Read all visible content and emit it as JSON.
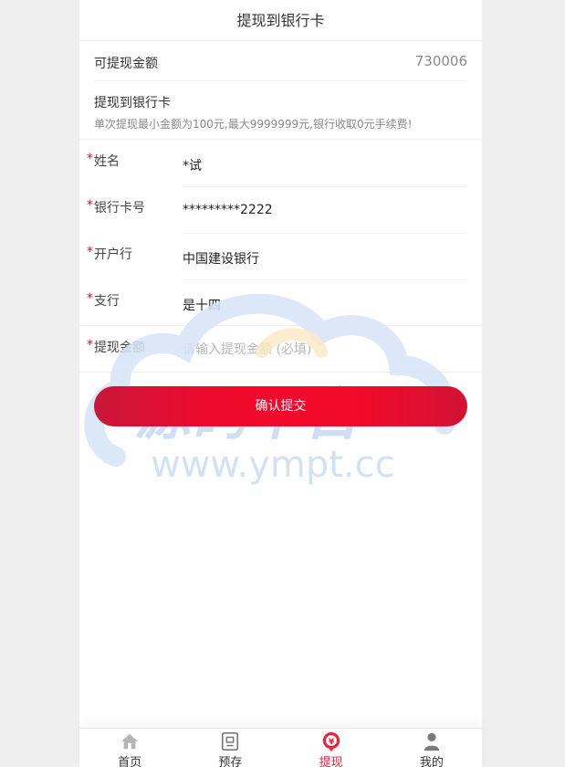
{
  "header": {
    "title": "提现到银行卡"
  },
  "balance": {
    "label": "可提现金额",
    "value": "730006"
  },
  "card_section": {
    "title": "提现到银行卡",
    "hint": "单次提现最小金额为100元,最大9999999元,银行收取0元手续费!"
  },
  "form": {
    "required_mark": "*",
    "name": {
      "label": "姓名",
      "value": "*试"
    },
    "card_no": {
      "label": "银行卡号",
      "value": "*********2222"
    },
    "bank": {
      "label": "开户行",
      "value": "中国建设银行"
    },
    "branch": {
      "label": "支行",
      "value": "是十四"
    },
    "amount": {
      "label": "提现金额",
      "placeholder": "请输入提现金额 (必填)"
    }
  },
  "submit": {
    "label": "确认提交"
  },
  "watermark": {
    "logo_text": "源码平台",
    "url": "www.ympt.cc"
  },
  "tabbar": {
    "items": [
      {
        "label": "首页",
        "icon": "home-icon"
      },
      {
        "label": "预存",
        "icon": "deposit-icon"
      },
      {
        "label": "提现",
        "icon": "withdraw-icon",
        "active": true
      },
      {
        "label": "我的",
        "icon": "user-icon"
      }
    ]
  },
  "colors": {
    "accent": "#e8233b",
    "button": "#ee0a2c",
    "background": "#efefef"
  }
}
